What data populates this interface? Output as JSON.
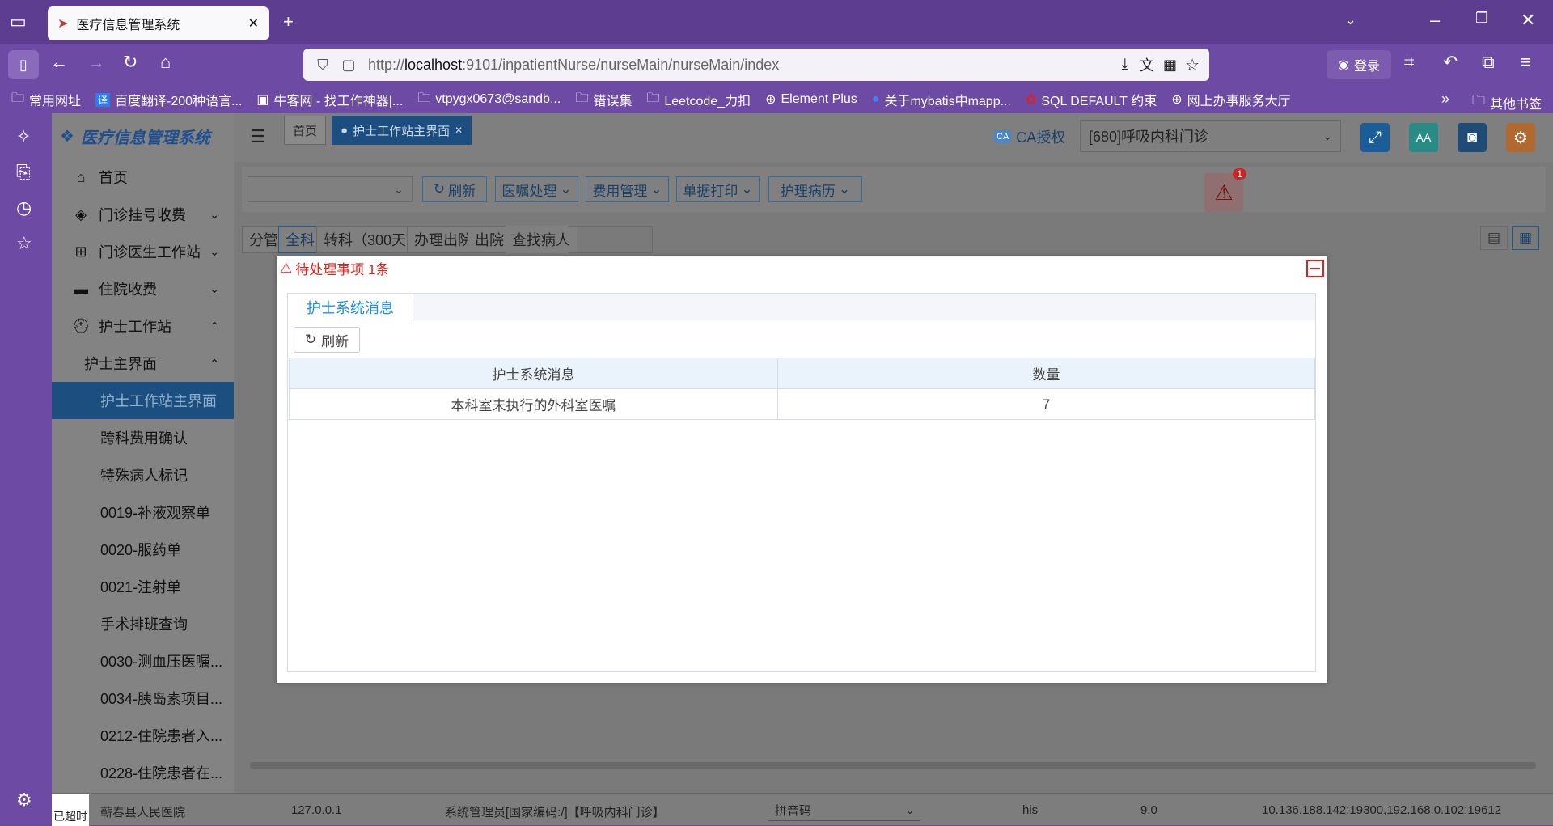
{
  "browser": {
    "tab_title": "医疗信息管理系统",
    "url_prefix": "http://",
    "url_host": "localhost",
    "url_rest": ":9101/inpatientNurse/nurseMain/nurseMain/index",
    "login_label": "登录",
    "bookmarks": [
      "常用网址",
      "百度翻译-200种语言...",
      "牛客网 - 找工作神器|...",
      "vtpygx0673@sandb...",
      "错误集",
      "Leetcode_力扣",
      "Element Plus",
      "关于mybatis中mapp...",
      "SQL DEFAULT 约束",
      "网上办事服务大厅"
    ],
    "other_bookmarks": "其他书签"
  },
  "app": {
    "logo_text": "医疗信息管理系统",
    "menu": [
      {
        "label": "首页"
      },
      {
        "label": "门诊挂号收费"
      },
      {
        "label": "门诊医生工作站"
      },
      {
        "label": "住院收费"
      },
      {
        "label": "护士工作站"
      },
      {
        "label": "护士主界面"
      },
      {
        "label": "护士工作站主界面"
      },
      {
        "label": "跨科费用确认"
      },
      {
        "label": "特殊病人标记"
      },
      {
        "label": "0019-补液观察单"
      },
      {
        "label": "0020-服药单"
      },
      {
        "label": "0021-注射单"
      },
      {
        "label": "手术排班查询"
      },
      {
        "label": "0030-测血压医嘱..."
      },
      {
        "label": "0034-胰岛素项目..."
      },
      {
        "label": "0212-住院患者入..."
      },
      {
        "label": "0228-住院患者在..."
      }
    ],
    "tags": {
      "home": "首页",
      "current": "护士工作站主界面"
    },
    "ca_label": "CA授权",
    "dept_select": "[680]呼吸内科门诊",
    "alarm_badge": "1",
    "toolbar": {
      "refresh": "刷新",
      "orders": "医嘱处理",
      "fees": "费用管理",
      "print": "单据打印",
      "records": "护理病历"
    },
    "filters": {
      "group": "分管",
      "all": "全科",
      "transfer": "转科（300天）",
      "discharge_proc": "办理出院",
      "discharged": "出院",
      "find": "查找病人"
    },
    "status": {
      "timeout": "已超时",
      "hospital": "蕲春县人民医院",
      "ip": "127.0.0.1",
      "user": "系统管理员[国家编码:/]【呼吸内科门诊】",
      "input_method": "拼音码",
      "app": "his",
      "version": "9.0",
      "addresses": "10.136.188.142:19300,192.168.0.102:19612"
    }
  },
  "dialog": {
    "title": "待处理事项 1条",
    "tab": "护士系统消息",
    "refresh": "刷新",
    "columns": [
      "护士系统消息",
      "数量"
    ],
    "rows": [
      [
        "本科室未执行的外科室医嘱",
        "7"
      ]
    ]
  }
}
